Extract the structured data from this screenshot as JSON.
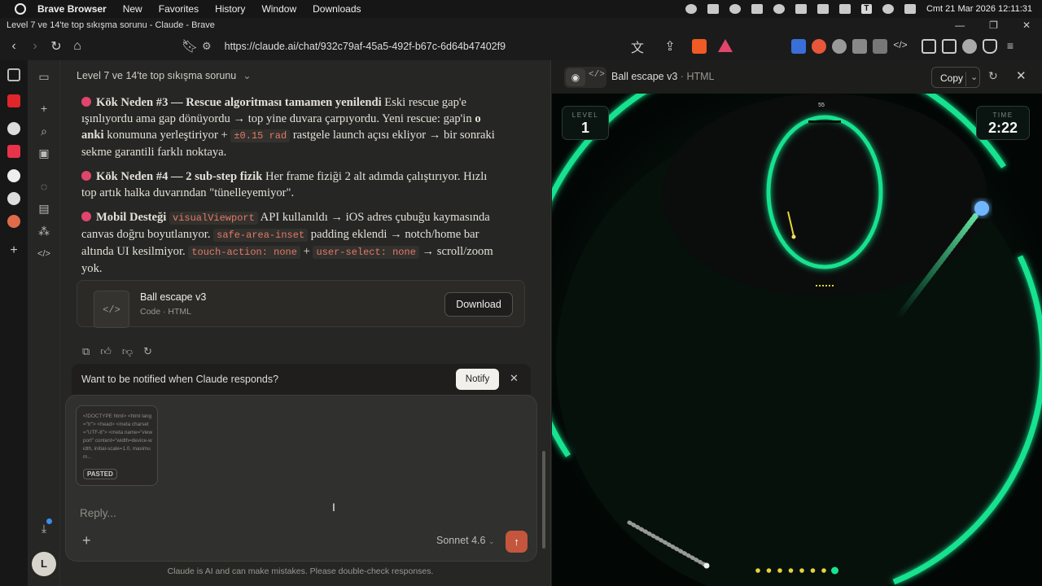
{
  "menubar": {
    "app": "Brave Browser",
    "items": [
      "New",
      "Favorites",
      "History",
      "Window",
      "Downloads"
    ],
    "clock": "Cmt 21 Mar 2026 12:11:31"
  },
  "window": {
    "title": "Level 7 ve 14'te top sıkışma sorunu - Claude - Brave"
  },
  "toolbar": {
    "url": "https://claude.ai/chat/932c79af-45a5-492f-b67c-6d64b47402f9"
  },
  "chat": {
    "title": "Level 7 ve 14'te top sıkışma sorunu",
    "messages": {
      "p1_head": "Kök Neden #3 — Rescue algoritması tamamen yenilendi",
      "p1_a": " Eski rescue gap'e ışınlıyordu ama gap dönüyordu → top yine duvara çarpıyordu. Yeni rescue: gap'in ",
      "p1_b": "o anki",
      "p1_c": " konumuna yerleştiriyor + ",
      "p1_code": "±0.15 rad",
      "p1_d": " rastgele launch açısı ekliyor → bir sonraki sekme garantili farklı noktaya.",
      "p2_head": "Kök Neden #4 — 2 sub-step fizik",
      "p2_a": " Her frame fiziği 2 alt adımda çalıştırıyor. Hızlı top artık halka duvarından \"tünelleyemiyor\".",
      "p3_head": "Mobil Desteği",
      "p3_code1": "visualViewport",
      "p3_a": " API kullanıldı → iOS adres çubuğu kaymasında canvas doğru boyutlanıyor. ",
      "p3_code2": "safe-area-inset",
      "p3_b": " padding eklendi → notch/home bar altında UI kesilmiyor. ",
      "p3_code3": "touch-action: none",
      "p3_c": " + ",
      "p3_code4": "user-select: none",
      "p3_d": " → scroll/zoom yok."
    },
    "artifact": {
      "name": "Ball escape v3",
      "type": "Code · HTML",
      "download": "Download"
    },
    "notify": {
      "text": "Want to be notified when Claude responds?",
      "button": "Notify"
    },
    "composer": {
      "pasted_preview": "<!DOCTYPE html> <html lang=\"tr\"> <head> <meta charset=\"UTF-8\"> <meta name=\"viewport\" content=\"width=device-width, initial-scale=1.0, maximum...",
      "pasted_label": "PASTED",
      "placeholder": "Reply...",
      "model": "Sonnet 4.6"
    },
    "disclaimer": "Claude is AI and can make mistakes. Please double-check responses.",
    "avatar": "L"
  },
  "panel": {
    "title": "Ball escape",
    "version": "v3",
    "subtitle": "HTML",
    "copy": "Copy",
    "game": {
      "level_label": "LEVEL",
      "level": "1",
      "time_label": "TIME",
      "time": "2:22",
      "top_number": "55",
      "balls_remaining": 8,
      "colors": {
        "ring": "#19e28f",
        "ball": "#6fb7ff",
        "dots": "#e6d43a"
      }
    }
  }
}
